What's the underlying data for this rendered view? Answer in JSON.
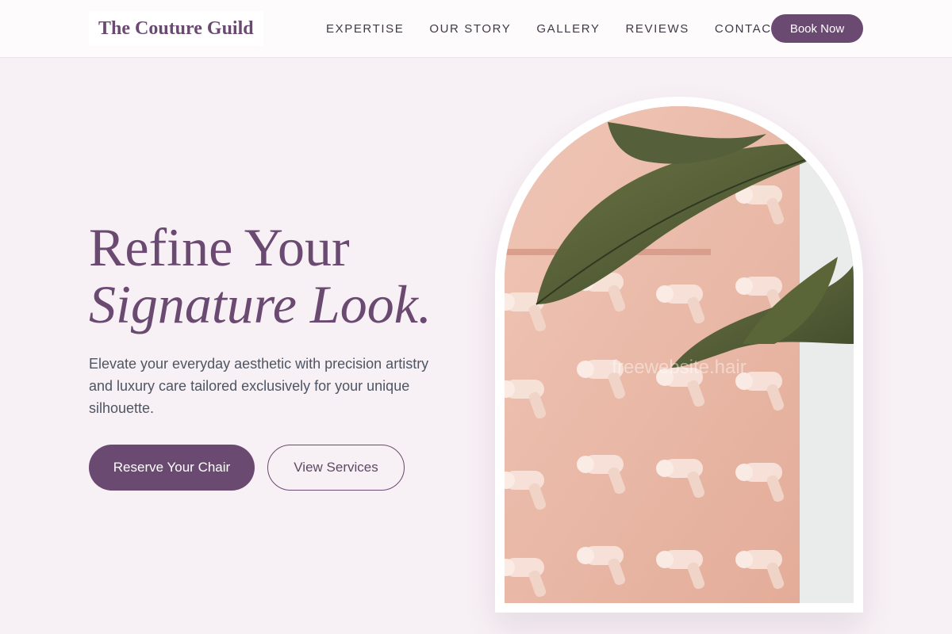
{
  "header": {
    "brand": "The Couture Guild",
    "nav": [
      "EXPERTISE",
      "OUR STORY",
      "GALLERY",
      "REVIEWS",
      "CONTACT"
    ],
    "cta_label": "Book Now"
  },
  "hero": {
    "title_line1": "Refine Your",
    "title_line2": "Signature Look.",
    "subtitle": "Elevate your everyday aesthetic with precision artistry and luxury care tailored exclusively for your unique silhouette.",
    "primary_button": "Reserve Your Chair",
    "secondary_button": "View Services",
    "image_watermark": "freewebsite.hair"
  },
  "colors": {
    "accent": "#6b4a72",
    "background": "#f7f0f4",
    "image_wall": "#eab8a6",
    "foliage": "#4e5b35"
  }
}
